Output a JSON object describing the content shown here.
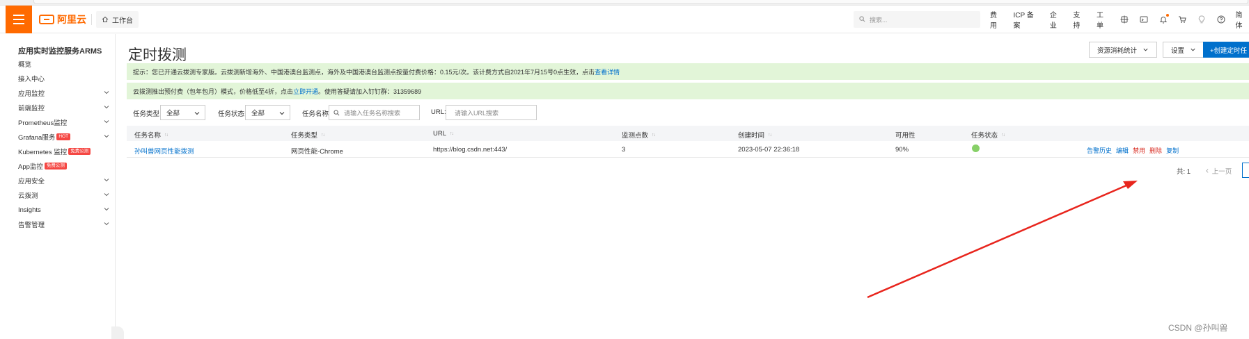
{
  "header": {
    "logo_text": "阿里云",
    "workbench": "工作台",
    "search_placeholder": "搜索...",
    "links": [
      "费用",
      "ICP 备案",
      "企业",
      "支持",
      "工单"
    ],
    "language": "简体"
  },
  "sidebar": {
    "title": "应用实时监控服务ARMS",
    "items": [
      {
        "label": "概览",
        "has_arrow": false
      },
      {
        "label": "接入中心",
        "has_arrow": false
      },
      {
        "label": "应用监控",
        "has_arrow": true
      },
      {
        "label": "前端监控",
        "has_arrow": true
      },
      {
        "label": "Prometheus监控",
        "has_arrow": true
      },
      {
        "label": "Grafana服务",
        "badge": "HOT",
        "has_arrow": true
      },
      {
        "label": "Kubernetes 监控",
        "badge": "免费公测",
        "has_arrow": false
      },
      {
        "label": "App监控",
        "badge": "免费公测",
        "has_arrow": false
      },
      {
        "label": "应用安全",
        "has_arrow": true
      },
      {
        "label": "云拨测",
        "has_arrow": true
      },
      {
        "label": "Insights",
        "has_arrow": true
      },
      {
        "label": "告警管理",
        "has_arrow": true
      }
    ]
  },
  "main": {
    "title": "定时拨测",
    "buttons": {
      "resource_stats": "资源消耗统计",
      "settings": "设置",
      "create": "+创建定时任"
    },
    "notice1": {
      "text": "提示：您已开通云拨测专家版。云拨测新增海外、中国港澳台监测点，海外及中国港澳台监测点按量付费价格：0.15元/次。该计费方式自2021年7月15号0点生效，点击",
      "link": "查看详情"
    },
    "notice2": {
      "text_before": "云拨测推出预付费（包年包月）模式，价格低至4折，点击",
      "link": "立即开通",
      "text_after": "。使用答疑请加入钉钉群：31359689"
    },
    "filters": {
      "type_label": "任务类型:",
      "type_value": "全部",
      "status_label": "任务状态:",
      "status_value": "全部",
      "name_label": "任务名称:",
      "name_placeholder": "请输入任务名称搜索",
      "url_label": "URL:",
      "url_placeholder": "请输入URL搜索"
    },
    "table": {
      "columns": [
        "任务名称",
        "任务类型",
        "URL",
        "监测点数",
        "创建时间",
        "可用性",
        "任务状态"
      ],
      "rows": [
        {
          "name": "孙叫兽网页性能拨测",
          "type": "网页性能-Chrome",
          "url": "https://blog.csdn.net:443/",
          "points": "3",
          "created": "2023-05-07 22:36:18",
          "availability": "90%",
          "status_color": "#87d068",
          "actions": [
            "告警历史",
            "编辑",
            "禁用",
            "删除",
            "复制"
          ]
        }
      ]
    },
    "pagination": {
      "total": "共: 1",
      "prev": "上一页"
    }
  },
  "annotation": {
    "arrow_color": "#e8251d"
  },
  "watermark": "CSDN @孙叫兽"
}
